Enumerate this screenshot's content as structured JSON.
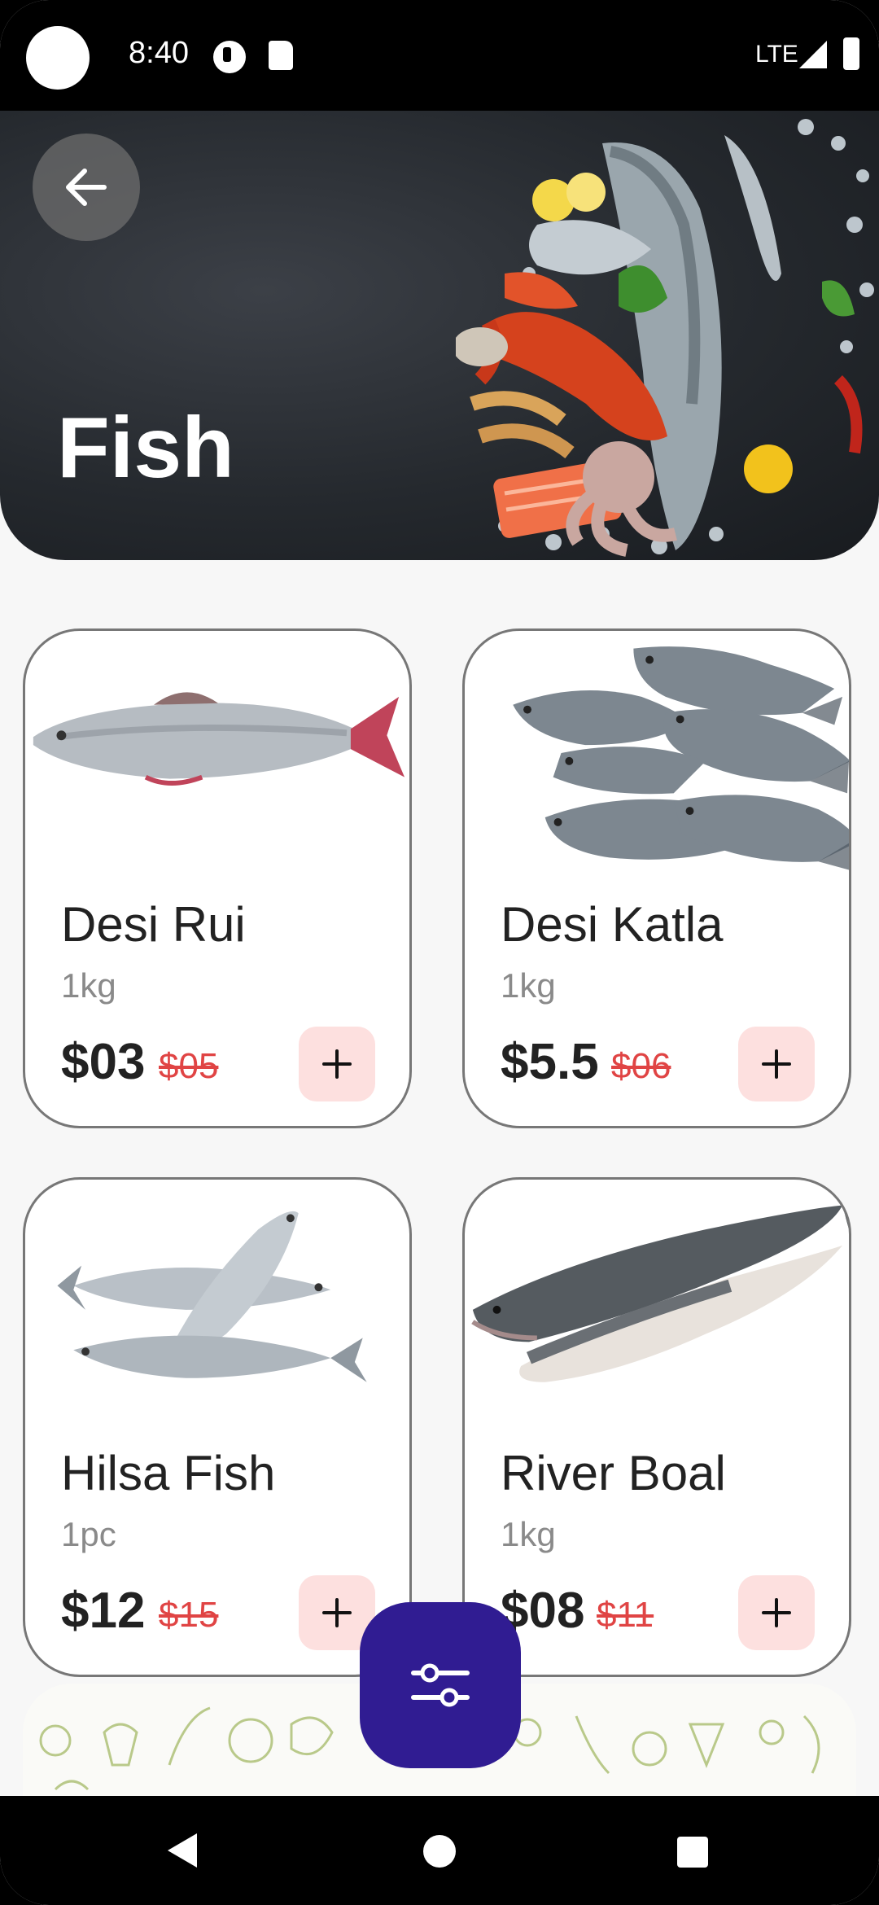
{
  "status_bar": {
    "time": "8:40",
    "network": "LTE"
  },
  "header": {
    "title": "Fish"
  },
  "products": [
    {
      "name": "Desi Rui",
      "unit": "1kg",
      "price": "$03",
      "old_price": "$05"
    },
    {
      "name": "Desi Katla",
      "unit": "1kg",
      "price": "$5.5",
      "old_price": "$06"
    },
    {
      "name": "Hilsa Fish",
      "unit": "1pc",
      "price": "$12",
      "old_price": "$15"
    },
    {
      "name": "River Boal",
      "unit": "1kg",
      "price": "$08",
      "old_price": "$11"
    }
  ],
  "icons": {
    "back": "arrow-left-icon",
    "add": "plus-icon",
    "filter": "sliders-icon",
    "nav": [
      "back-triangle-icon",
      "home-circle-icon",
      "recents-square-icon"
    ]
  },
  "colors": {
    "fab": "#301c92",
    "add_button_bg": "#fde0df",
    "old_price": "#e04444",
    "header_bg": "#25292e"
  }
}
